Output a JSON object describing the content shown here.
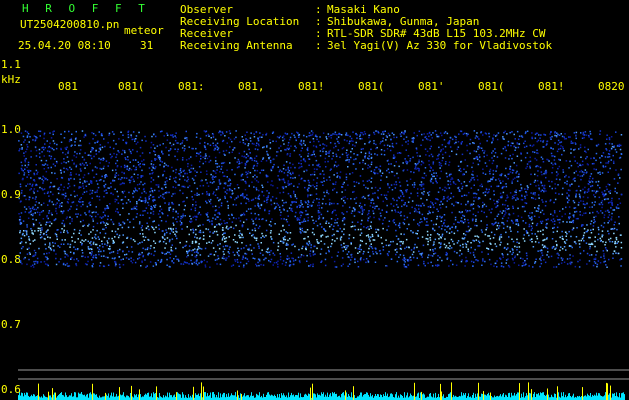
{
  "header": {
    "title": "H R O F F T",
    "filename": "UT2504200810.pn",
    "label": "meteor",
    "date_time": "25.04.20 08:10",
    "count": "31"
  },
  "info": [
    {
      "key": "Observer",
      "value": "Masaki Kano"
    },
    {
      "key": "Receiving Location",
      "value": "Shibukawa, Gunma, Japan"
    },
    {
      "key": "Receiver",
      "value": "RTL-SDR SDR# 43dB L15 103.2MHz CW"
    },
    {
      "key": "Receiving Antenna",
      "value": "3el Yagi(V) Az 330 for Vladivostok"
    }
  ],
  "colors": {
    "background": "#000000",
    "text": "#ffff00",
    "title": "#33ff33",
    "signal_low": "#0a1a8c",
    "signal_high": "#8fd8ff",
    "baseline": "#00e5ff"
  },
  "chart_data": {
    "type": "heatmap",
    "y_unit": "kHz",
    "x_tick_labels": [
      "081",
      "081(",
      "081:",
      "081,",
      "081!",
      "081(",
      "081'",
      "081(",
      "081!",
      "0820"
    ],
    "y_tick_labels": [
      "1.1",
      "1.0",
      "0.9",
      "0.8",
      "0.7",
      "0.6"
    ],
    "y_ticks": [
      1.1,
      1.0,
      0.9,
      0.8,
      0.7,
      0.6
    ],
    "ylim": [
      0.585,
      1.2
    ],
    "noise_band_khz": [
      0.79,
      1.0
    ],
    "noise_peak_khz": 0.835,
    "grid": false
  }
}
